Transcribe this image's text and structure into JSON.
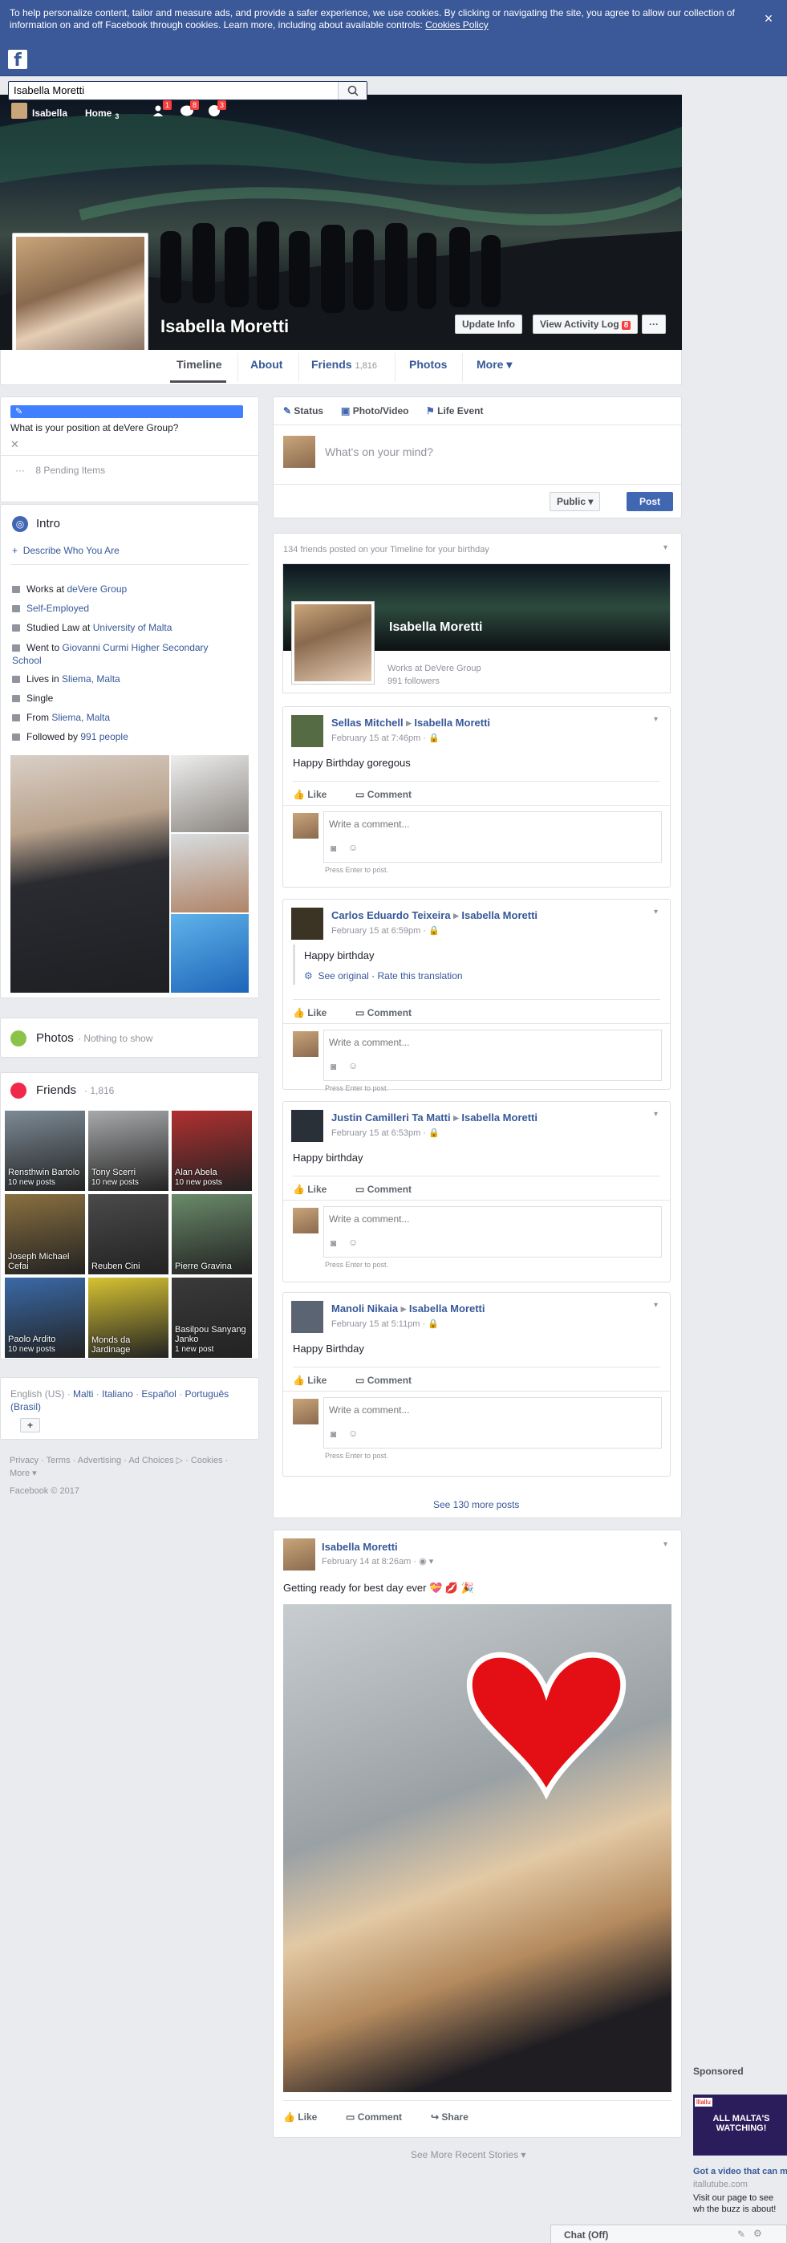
{
  "cookie_bar": {
    "text": "To help personalize content, tailor and measure ads, and provide a safer experience, we use cookies. By clicking or navigating the site, you agree to allow our collection of information on and off Facebook through cookies. Learn more, including about available controls: ",
    "link": "Cookies Policy",
    "close": "×"
  },
  "header": {
    "search_value": "Isabella Moretti",
    "user_name": "Isabella",
    "home": "Home",
    "home_count": "3",
    "badges": {
      "friends": "1",
      "messages": "8",
      "notifications": "3"
    }
  },
  "profile": {
    "name": "Isabella Moretti",
    "update_info": "Update Info",
    "activity_log": "View Activity Log",
    "activity_badge": "8",
    "more_dots": "···",
    "tabs": {
      "timeline": "Timeline",
      "about": "About",
      "friends": "Friends",
      "friends_count": "1,816",
      "photos": "Photos",
      "more": "More ▾"
    }
  },
  "left": {
    "work_prompt": "What is your position at deVere Group?",
    "pending": "8 Pending Items",
    "intro": {
      "title": "Intro",
      "describe": "Describe Who You Are",
      "works_at": "Works at ",
      "works_at_link": "deVere Group",
      "self_employed": "Self-Employed",
      "studied": "Studied Law at ",
      "studied_link": "University of Malta",
      "went": "Went to ",
      "went_link": "Giovanni Curmi Higher Secondary School",
      "lives": "Lives in ",
      "lives_link": "Sliema, Malta",
      "single": "Single",
      "from": "From ",
      "from_link": "Sliema, Malta",
      "followed": "Followed by ",
      "followed_link": "991 people"
    },
    "photos": {
      "title": "Photos",
      "sub": "· Nothing to show"
    },
    "friends": {
      "title": "Friends",
      "count": "· 1,816",
      "list": [
        {
          "name": "Rensthwin Bartolo",
          "sub": "10 new posts"
        },
        {
          "name": "Tony Scerri",
          "sub": "10 new posts"
        },
        {
          "name": "Alan Abela",
          "sub": "10 new posts"
        },
        {
          "name": "Joseph Michael Cefai",
          "sub": ""
        },
        {
          "name": "Reuben Cini",
          "sub": ""
        },
        {
          "name": "Pierre Gravina",
          "sub": ""
        },
        {
          "name": "Paolo Ardito",
          "sub": "10 new posts"
        },
        {
          "name": "Monds da Jardinage",
          "sub": ""
        },
        {
          "name": "Basilpou Sanyang Janko",
          "sub": "1 new post"
        }
      ]
    },
    "languages": {
      "current": "English (US) · ",
      "l1": "Malti",
      "l2": "Italiano",
      "l3": "Español",
      "l4": "Português (Brasil)",
      "add": "+"
    },
    "footer": "Privacy · Terms · Advertising · Ad Choices ▷ · Cookies · More ▾",
    "copyright": "Facebook © 2017"
  },
  "composer": {
    "status": "Status",
    "photo_video": "Photo/Video",
    "life_event": "Life Event",
    "placeholder": "What's on your mind?",
    "privacy": "Public ▾",
    "post": "Post"
  },
  "birthday": {
    "header": "134 friends posted on your Timeline for your birthday",
    "card_name": "Isabella Moretti",
    "card_work": "Works at DeVere Group",
    "card_followers": "991 followers",
    "see_more": "See 130 more posts",
    "posts": [
      {
        "author": "Sellas Mitchell",
        "target": "Isabella Moretti",
        "date": "February 15 at 7:46pm",
        "text": "Happy Birthday goregous"
      },
      {
        "author": "Carlos Eduardo Teixeira",
        "target": "Isabella Moretti",
        "date": "February 15 at 6:59pm",
        "text": "Happy birthday",
        "see_original": "See original",
        "rate": "Rate this translation"
      },
      {
        "author": "Justin Camilleri Ta Matti",
        "target": "Isabella Moretti",
        "date": "February 15 at 6:53pm",
        "text": "Happy birthday"
      },
      {
        "author": "Manoli Nikaia",
        "target": "Isabella Moretti",
        "date": "February 15 at 5:11pm",
        "text": "Happy Birthday"
      }
    ],
    "like": "Like",
    "comment": "Comment",
    "write_comment": "Write a comment...",
    "press_enter": "Press Enter to post."
  },
  "story": {
    "author": "Isabella Moretti",
    "date": "February 14 at 8:26am · ",
    "text": "Getting ready for best day ever",
    "like": "Like",
    "comment": "Comment",
    "share": "Share"
  },
  "see_more_stories": "See More Recent Stories ▾",
  "sponsored": {
    "label": "Sponsored",
    "ad_text": "ALL MALTA'S WATCHING!",
    "title": "Got a video that can m",
    "domain": "itallutube.com",
    "desc": "Visit our page to see wh the buzz is about!"
  },
  "chat": {
    "label": "Chat (Off)"
  },
  "colors": {
    "brand": "#3b5998",
    "link": "#365899",
    "badge": "#fa3e3e"
  }
}
